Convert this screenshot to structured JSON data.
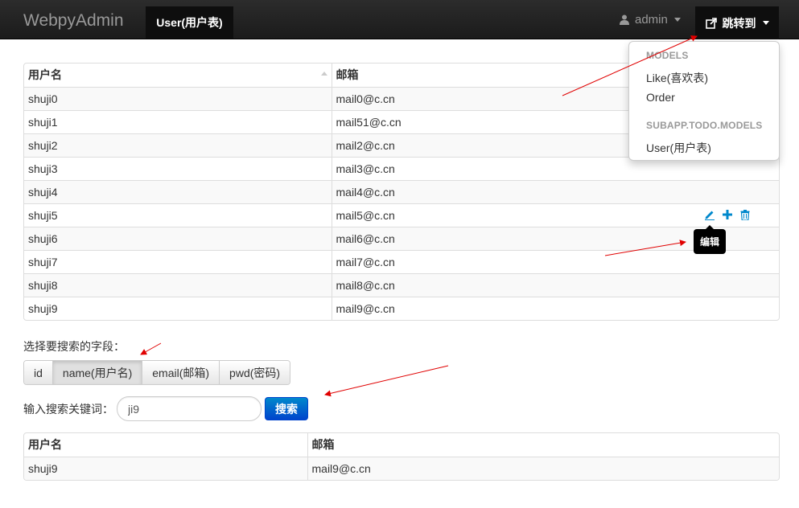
{
  "navbar": {
    "brand": "WebpyAdmin",
    "active_tab": "User(用户表)",
    "user_menu": "admin",
    "jump_menu": "跳转到"
  },
  "dropdown": {
    "groups": [
      {
        "header": "MODELS",
        "items": [
          "Like(喜欢表)",
          "Order"
        ]
      },
      {
        "header": "SUBAPP.TODO.MODELS",
        "items": [
          "User(用户表)"
        ]
      }
    ]
  },
  "main_table": {
    "headers": [
      "用户名",
      "邮箱"
    ],
    "rows": [
      [
        "shuji0",
        "mail0@c.cn"
      ],
      [
        "shuji1",
        "mail51@c.cn"
      ],
      [
        "shuji2",
        "mail2@c.cn"
      ],
      [
        "shuji3",
        "mail3@c.cn"
      ],
      [
        "shuji4",
        "mail4@c.cn"
      ],
      [
        "shuji5",
        "mail5@c.cn"
      ],
      [
        "shuji6",
        "mail6@c.cn"
      ],
      [
        "shuji7",
        "mail7@c.cn"
      ],
      [
        "shuji8",
        "mail8@c.cn"
      ],
      [
        "shuji9",
        "mail9@c.cn"
      ]
    ]
  },
  "row_actions": {
    "icons": [
      "edit-icon",
      "plus-icon",
      "trash-icon"
    ],
    "tooltip": "编辑"
  },
  "search": {
    "field_label": "选择要搜索的字段：",
    "fields": [
      "id",
      "name(用户名)",
      "email(邮箱)",
      "pwd(密码)"
    ],
    "selected_field": "name(用户名)",
    "keyword_label": "输入搜索关键词：",
    "keyword_value": "ji9",
    "button_label": "搜索"
  },
  "result_table": {
    "headers": [
      "用户名",
      "邮箱"
    ],
    "rows": [
      [
        "shuji9",
        "mail9@c.cn"
      ]
    ]
  },
  "colors": {
    "navbar_bg": "#1b1b1b",
    "primary_button": "#0044cc",
    "action_icon": "#0088cc",
    "annotation_arrow": "#e00000"
  }
}
